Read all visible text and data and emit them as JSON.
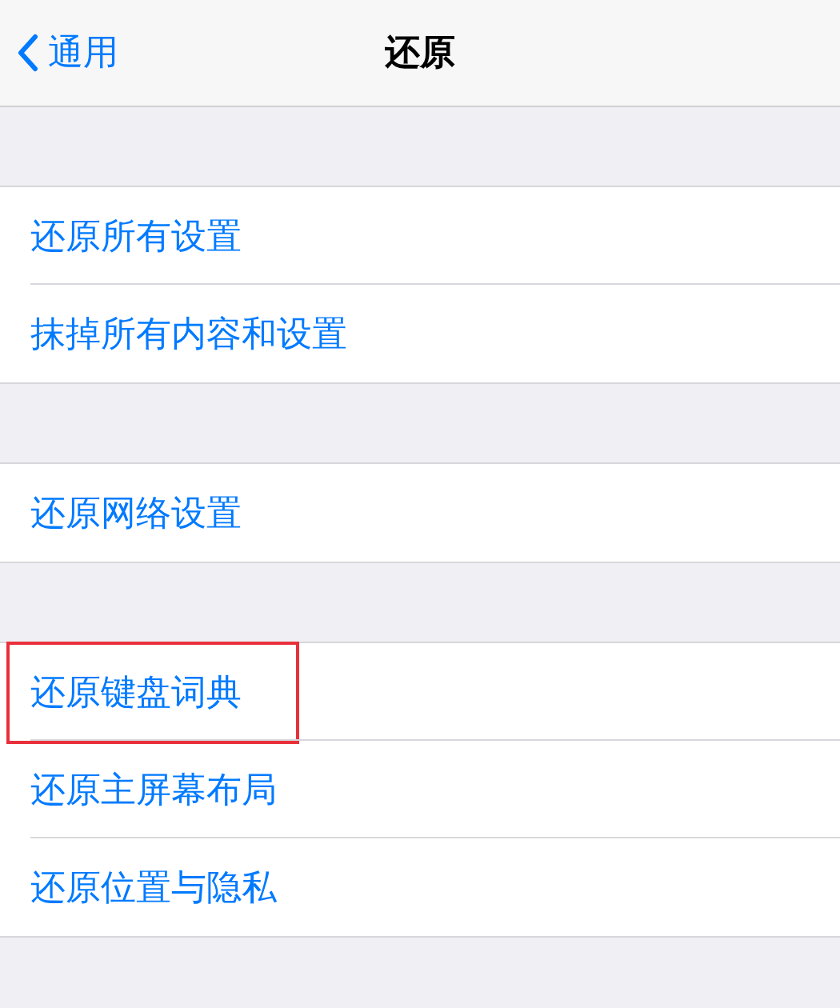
{
  "nav": {
    "back": "通用",
    "title": "还原"
  },
  "groups": [
    {
      "items": [
        {
          "label": "还原所有设置",
          "highlighted": false
        },
        {
          "label": "抹掉所有内容和设置",
          "highlighted": false
        }
      ]
    },
    {
      "items": [
        {
          "label": "还原网络设置",
          "highlighted": false
        }
      ]
    },
    {
      "items": [
        {
          "label": "还原键盘词典",
          "highlighted": true
        },
        {
          "label": "还原主屏幕布局",
          "highlighted": false
        },
        {
          "label": "还原位置与隐私",
          "highlighted": false
        }
      ]
    }
  ]
}
